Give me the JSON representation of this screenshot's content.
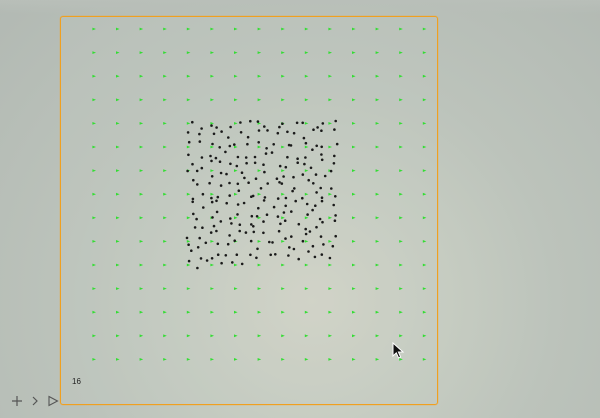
{
  "frame": {
    "label": "16",
    "border_color": "#f0a020"
  },
  "grid_markers": {
    "color": "#33dd33",
    "rows": 15,
    "cols": 15,
    "shape": "small green triangle"
  },
  "particles": {
    "color": "#1a1a1a",
    "count": 230,
    "region": "square cluster"
  },
  "controls": [
    {
      "name": "add",
      "icon": "plus-icon"
    },
    {
      "name": "next",
      "icon": "chevron-right-icon"
    },
    {
      "name": "play",
      "icon": "play-icon"
    }
  ],
  "cursor": {
    "icon": "mouse-pointer-icon"
  }
}
